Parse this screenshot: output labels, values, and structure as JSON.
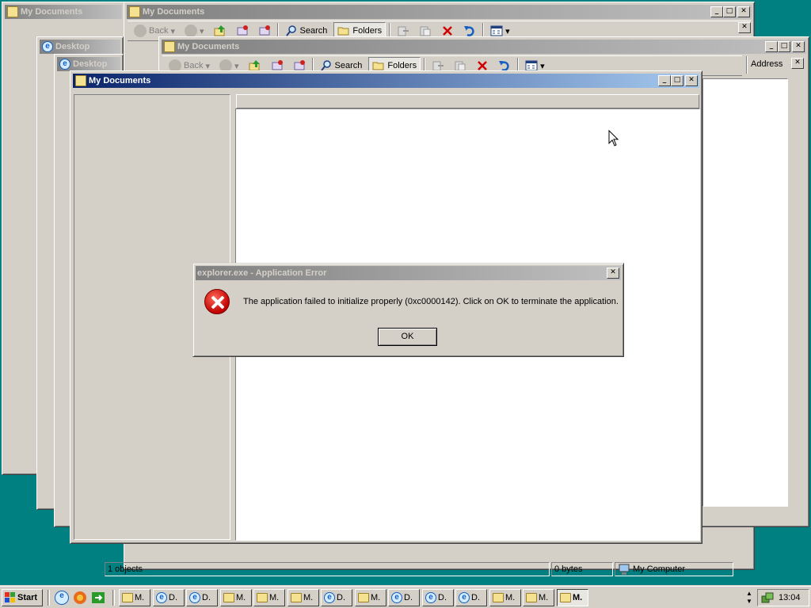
{
  "windows": {
    "back_left": {
      "title": "My Documents"
    },
    "back_top": {
      "title": "My Documents",
      "toolbar": {
        "back": "Back",
        "search": "Search",
        "folders": "Folders"
      }
    },
    "desktop1": {
      "title": "Desktop"
    },
    "mid": {
      "title": "My Documents",
      "toolbar": {
        "back": "Back",
        "search": "Search",
        "folders": "Folders",
        "address": "Address"
      }
    },
    "desktop2": {
      "title": "Desktop"
    },
    "front": {
      "title": "My Documents"
    }
  },
  "dialog": {
    "title": "explorer.exe - Application Error",
    "message": "The application failed to initialize properly (0xc0000142). Click on OK to terminate the application.",
    "ok_label": "OK",
    "icon": "error-icon"
  },
  "statusbar": {
    "objects": "1 objects",
    "size": "0 bytes",
    "zone": "My Computer"
  },
  "taskbar": {
    "start_label": "Start",
    "quick_launch": [
      "internet-explorer-icon",
      "firefox-icon",
      "show-desktop-icon"
    ],
    "tasks": [
      {
        "label": "M.",
        "icon": "folder-icon",
        "active": false
      },
      {
        "label": "D.",
        "icon": "ie-icon",
        "active": false
      },
      {
        "label": "D.",
        "icon": "ie-icon",
        "active": false
      },
      {
        "label": "M.",
        "icon": "folder-icon",
        "active": false
      },
      {
        "label": "M.",
        "icon": "folder-icon",
        "active": false
      },
      {
        "label": "M.",
        "icon": "folder-icon",
        "active": false
      },
      {
        "label": "D.",
        "icon": "ie-icon",
        "active": false
      },
      {
        "label": "M.",
        "icon": "folder-icon",
        "active": false
      },
      {
        "label": "D.",
        "icon": "ie-icon",
        "active": false
      },
      {
        "label": "D.",
        "icon": "ie-icon",
        "active": false
      },
      {
        "label": "D.",
        "icon": "ie-icon",
        "active": false
      },
      {
        "label": "M.",
        "icon": "folder-icon",
        "active": false
      },
      {
        "label": "M.",
        "icon": "folder-icon",
        "active": false
      },
      {
        "label": "M.",
        "icon": "folder-icon",
        "active": true
      }
    ],
    "clock": "13:04"
  }
}
